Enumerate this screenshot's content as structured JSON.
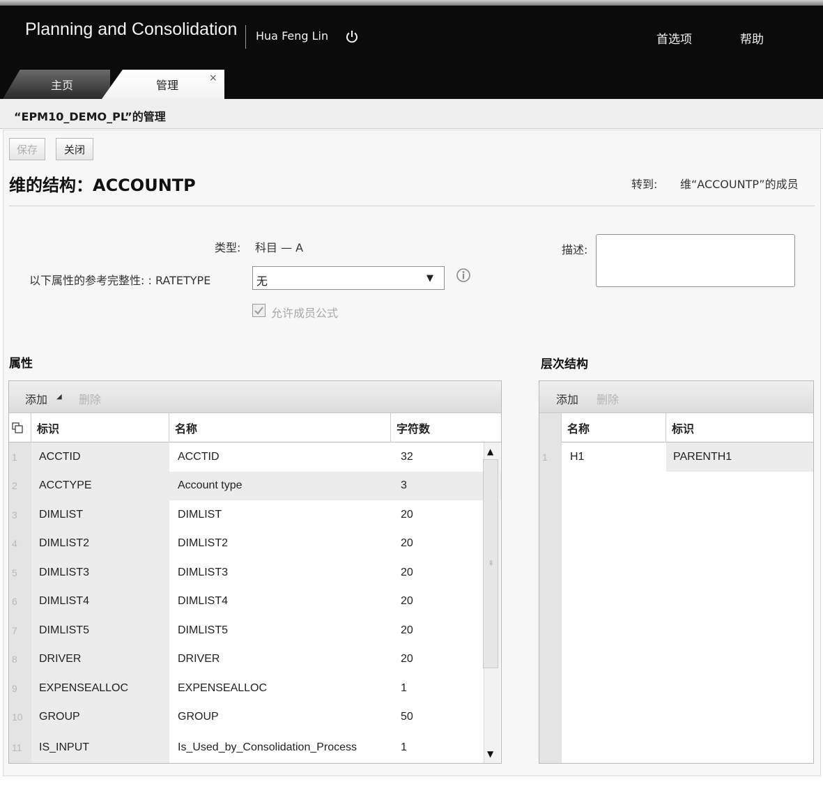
{
  "header": {
    "app_title": "Planning and Consolidation",
    "user": "Hua Feng Lin",
    "preferences": "首选项",
    "help": "帮助"
  },
  "tabs": [
    {
      "label": "主页",
      "active": false
    },
    {
      "label": "管理",
      "active": true,
      "close": "×"
    }
  ],
  "subheader": {
    "title": "“EPM10_DEMO_PL”的管理"
  },
  "toolbar": {
    "save_label": "保存",
    "close_label": "关闭"
  },
  "dimension": {
    "title": "维的结构：ACCOUNTP",
    "goto_label": "转到:",
    "goto_link": "维“ACCOUNTP”的成员"
  },
  "form": {
    "type_label": "类型:",
    "type_value": "科目 — A",
    "ref_label": "以下属性的参考完整性: : RATETYPE",
    "ratetype_value": "无",
    "allow_formula_label": "允许成员公式",
    "allow_formula_checked": true,
    "description_label": "描述:",
    "description_value": ""
  },
  "attributes": {
    "title": "属性",
    "add_label": "添加",
    "add_caret": "◢",
    "delete_label": "删除",
    "columns": [
      "标识",
      "名称",
      "字符数"
    ],
    "rows": [
      {
        "num": "1",
        "id": "ACCTID",
        "name": "ACCTID",
        "length": "32"
      },
      {
        "num": "2",
        "id": "ACCTYPE",
        "name": "Account type",
        "length": "3"
      },
      {
        "num": "3",
        "id": "DIMLIST",
        "name": "DIMLIST",
        "length": "20"
      },
      {
        "num": "4",
        "id": "DIMLIST2",
        "name": "DIMLIST2",
        "length": "20"
      },
      {
        "num": "5",
        "id": "DIMLIST3",
        "name": "DIMLIST3",
        "length": "20"
      },
      {
        "num": "6",
        "id": "DIMLIST4",
        "name": "DIMLIST4",
        "length": "20"
      },
      {
        "num": "7",
        "id": "DIMLIST5",
        "name": "DIMLIST5",
        "length": "20"
      },
      {
        "num": "8",
        "id": "DRIVER",
        "name": "DRIVER",
        "length": "20"
      },
      {
        "num": "9",
        "id": "EXPENSEALLOC",
        "name": "EXPENSEALLOC",
        "length": "1"
      },
      {
        "num": "10",
        "id": "GROUP",
        "name": "GROUP",
        "length": "50"
      },
      {
        "num": "11",
        "id": "IS_INPUT",
        "name": "Is_Used_by_Consolidation_Process",
        "length": "1"
      }
    ]
  },
  "hierarchy": {
    "title": "层次结构",
    "add_label": "添加",
    "delete_label": "删除",
    "columns": [
      "名称",
      "标识"
    ],
    "rows": [
      {
        "num": "1",
        "name": "H1",
        "id": "PARENTH1"
      }
    ]
  },
  "icons": {
    "power": "power-icon",
    "info": "info-icon",
    "dropdown": "▼",
    "scroll_up": "▲",
    "scroll_down": "▼",
    "grip": "⁞⁞",
    "column_chooser": "column-chooser-icon"
  },
  "colors": {
    "header_bg": "#0b0b0b",
    "content_bg": "#f7f7f7",
    "id_column_bg": "#ececec"
  }
}
